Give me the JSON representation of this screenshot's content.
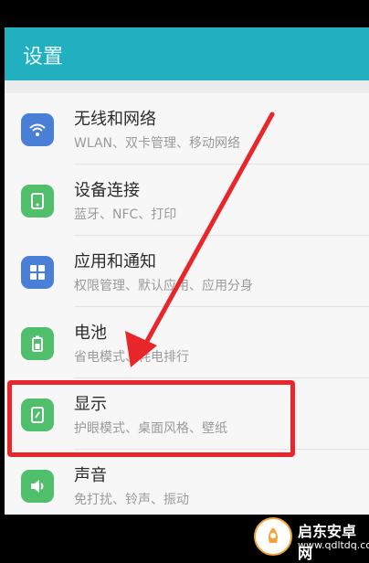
{
  "header": {
    "title": "设置"
  },
  "items": [
    {
      "title": "无线和网络",
      "subtitle": "WLAN、双卡管理、移动网络",
      "icon": "wifi-icon",
      "color": "#4a7fd8"
    },
    {
      "title": "设备连接",
      "subtitle": "蓝牙、NFC、打印",
      "icon": "device-connect-icon",
      "color": "#4fbf6b"
    },
    {
      "title": "应用和通知",
      "subtitle": "权限管理、默认应用、应用分身",
      "icon": "apps-icon",
      "color": "#4a7fd8"
    },
    {
      "title": "电池",
      "subtitle": "省电模式、耗电排行",
      "icon": "battery-icon",
      "color": "#4fbf6b"
    },
    {
      "title": "显示",
      "subtitle": "护眼模式、桌面风格、壁纸",
      "icon": "display-icon",
      "color": "#4fbf6b"
    },
    {
      "title": "声音",
      "subtitle": "免打扰、铃声、振动",
      "icon": "sound-icon",
      "color": "#4fbf6b"
    }
  ],
  "highlight_color": "#e8262c",
  "watermark": {
    "title": "启东安卓网",
    "url": "www.qdltdq.com"
  }
}
